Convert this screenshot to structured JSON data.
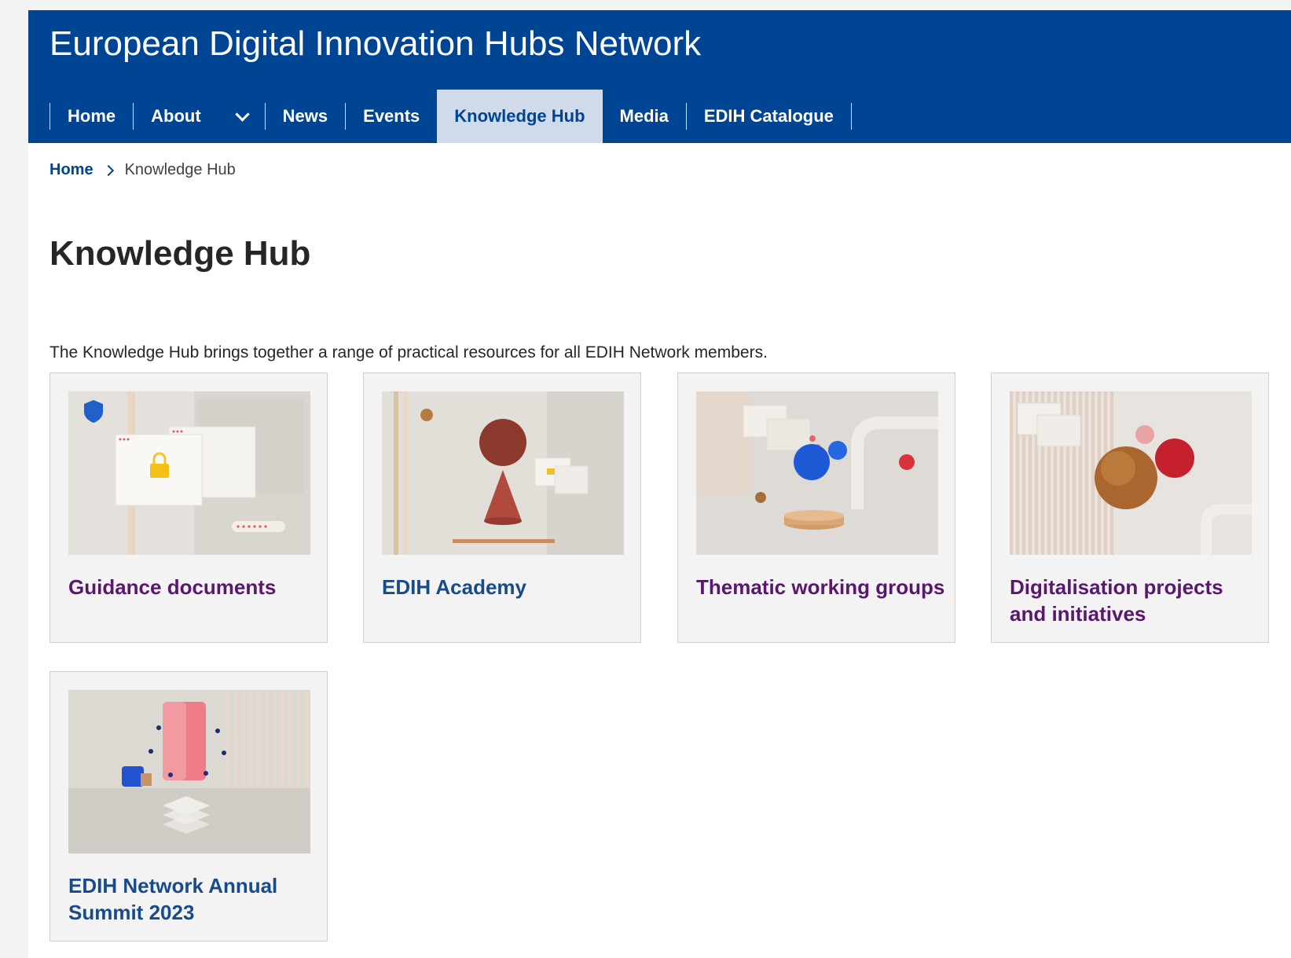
{
  "header": {
    "site_title": "European Digital Innovation Hubs Network",
    "nav": [
      {
        "label": "Home"
      },
      {
        "label": "About"
      },
      {
        "label": "News"
      },
      {
        "label": "Events"
      },
      {
        "label": "Knowledge Hub",
        "active": true
      },
      {
        "label": "Media"
      },
      {
        "label": "EDIH Catalogue"
      }
    ]
  },
  "breadcrumb": {
    "home": "Home",
    "current": "Knowledge Hub"
  },
  "main": {
    "title": "Knowledge Hub",
    "intro": "The Knowledge Hub brings together a range of practical resources for all EDIH Network members.",
    "cards": [
      {
        "title": "Guidance documents",
        "image": "security-lock-illustration"
      },
      {
        "title": "EDIH Academy",
        "image": "cone-sphere-illustration"
      },
      {
        "title": "Thematic working groups",
        "image": "spheres-podium-illustration"
      },
      {
        "title": "Digitalisation projects and initiatives",
        "image": "wooden-sphere-illustration"
      },
      {
        "title": "EDIH Network Annual Summit 2023",
        "image": "pink-block-layers-illustration"
      }
    ]
  },
  "colors": {
    "header_bg": "#004494",
    "active_tab_bg": "#cfdaea",
    "link_blue": "#004494",
    "visited_purple": "#5a176e"
  }
}
